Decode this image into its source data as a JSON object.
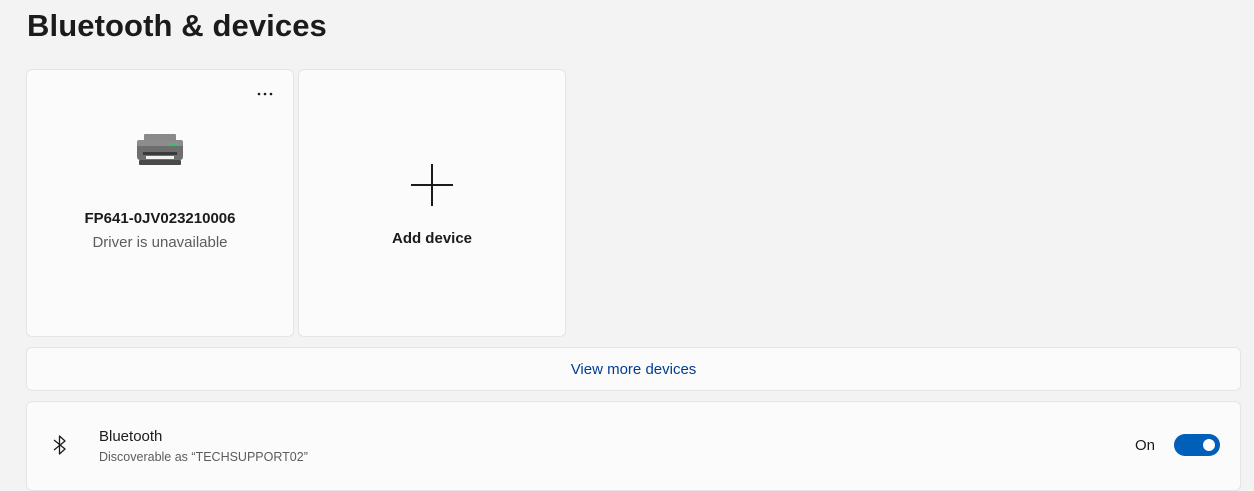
{
  "page": {
    "title": "Bluetooth & devices"
  },
  "devices": [
    {
      "name": "FP641-0JV023210006",
      "status": "Driver is unavailable",
      "icon": "printer-icon",
      "more_icon": "more-options-icon",
      "more_label": "..."
    }
  ],
  "add_device": {
    "label": "Add device",
    "icon": "plus-icon"
  },
  "view_more": {
    "label": "View more devices"
  },
  "bluetooth": {
    "title": "Bluetooth",
    "subtitle": "Discoverable as “TECHSUPPORT02”",
    "state_label": "On",
    "enabled": true,
    "icon": "bluetooth-icon"
  },
  "colors": {
    "accent": "#005fb8",
    "link": "#003e92",
    "background": "#f3f3f3",
    "card": "#fbfbfb"
  }
}
